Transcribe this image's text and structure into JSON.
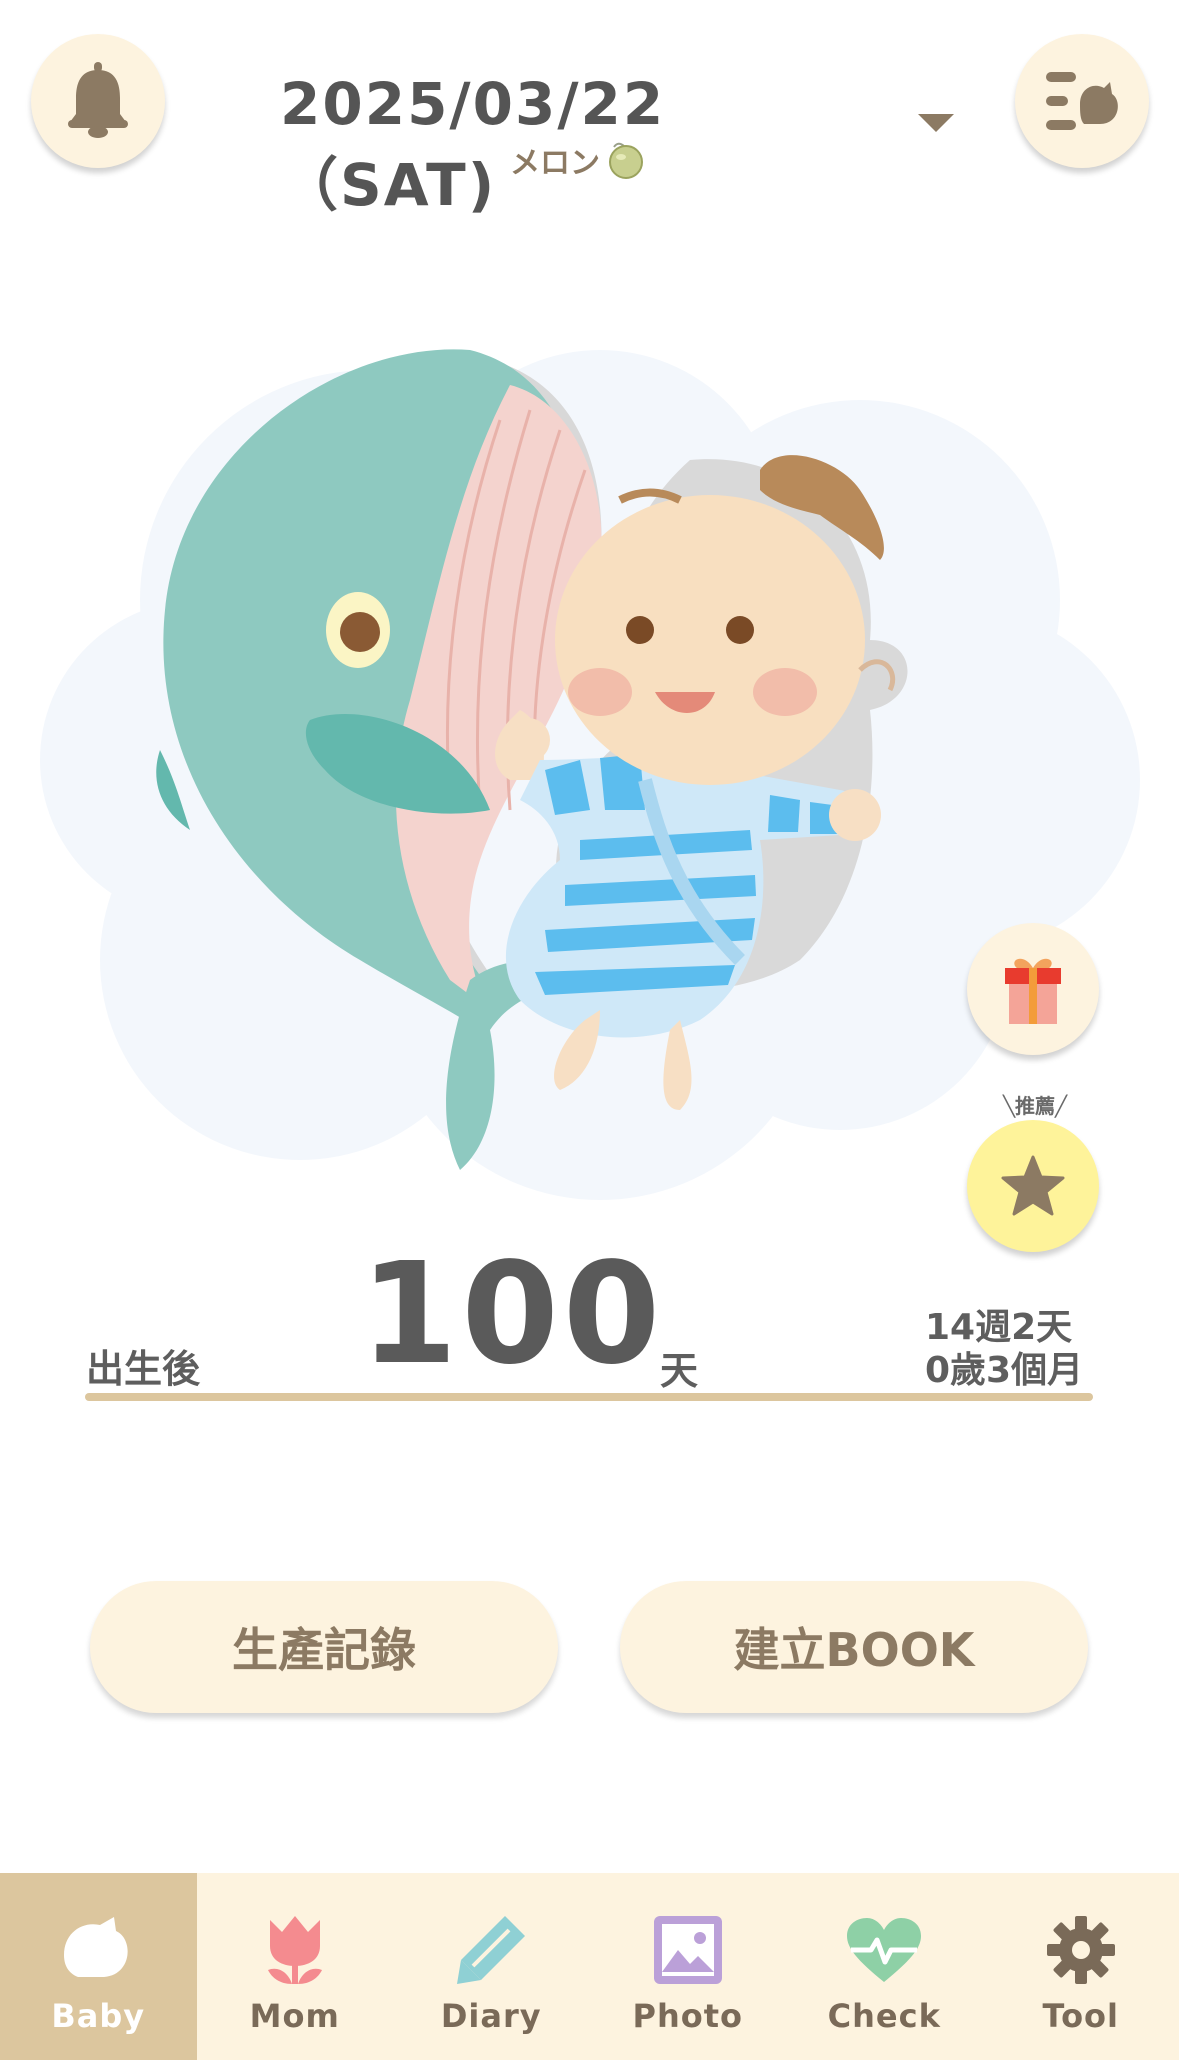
{
  "header": {
    "date": "2025/03/22（SAT)",
    "fruit_size": "メロン"
  },
  "recommend_label": "╲推薦╱",
  "counter": {
    "birth_label": "出生後",
    "days": "100",
    "days_unit": "天",
    "weeks": "14週2天",
    "months": "0歲3個月"
  },
  "buttons": {
    "birth_record": "生產記錄",
    "create_book": "建立BOOK"
  },
  "nav": {
    "items": [
      {
        "label": "Baby",
        "icon": "baby-bird-icon",
        "active": true
      },
      {
        "label": "Mom",
        "icon": "tulip-icon"
      },
      {
        "label": "Diary",
        "icon": "pencil-icon"
      },
      {
        "label": "Photo",
        "icon": "photo-icon"
      },
      {
        "label": "Check",
        "icon": "heartbeat-icon"
      },
      {
        "label": "Tool",
        "icon": "gear-icon"
      }
    ]
  },
  "colors": {
    "cream": "#fdf3df",
    "tan": "#dcc69e",
    "brown": "#8c7a63",
    "star_yellow": "#fef39a"
  }
}
